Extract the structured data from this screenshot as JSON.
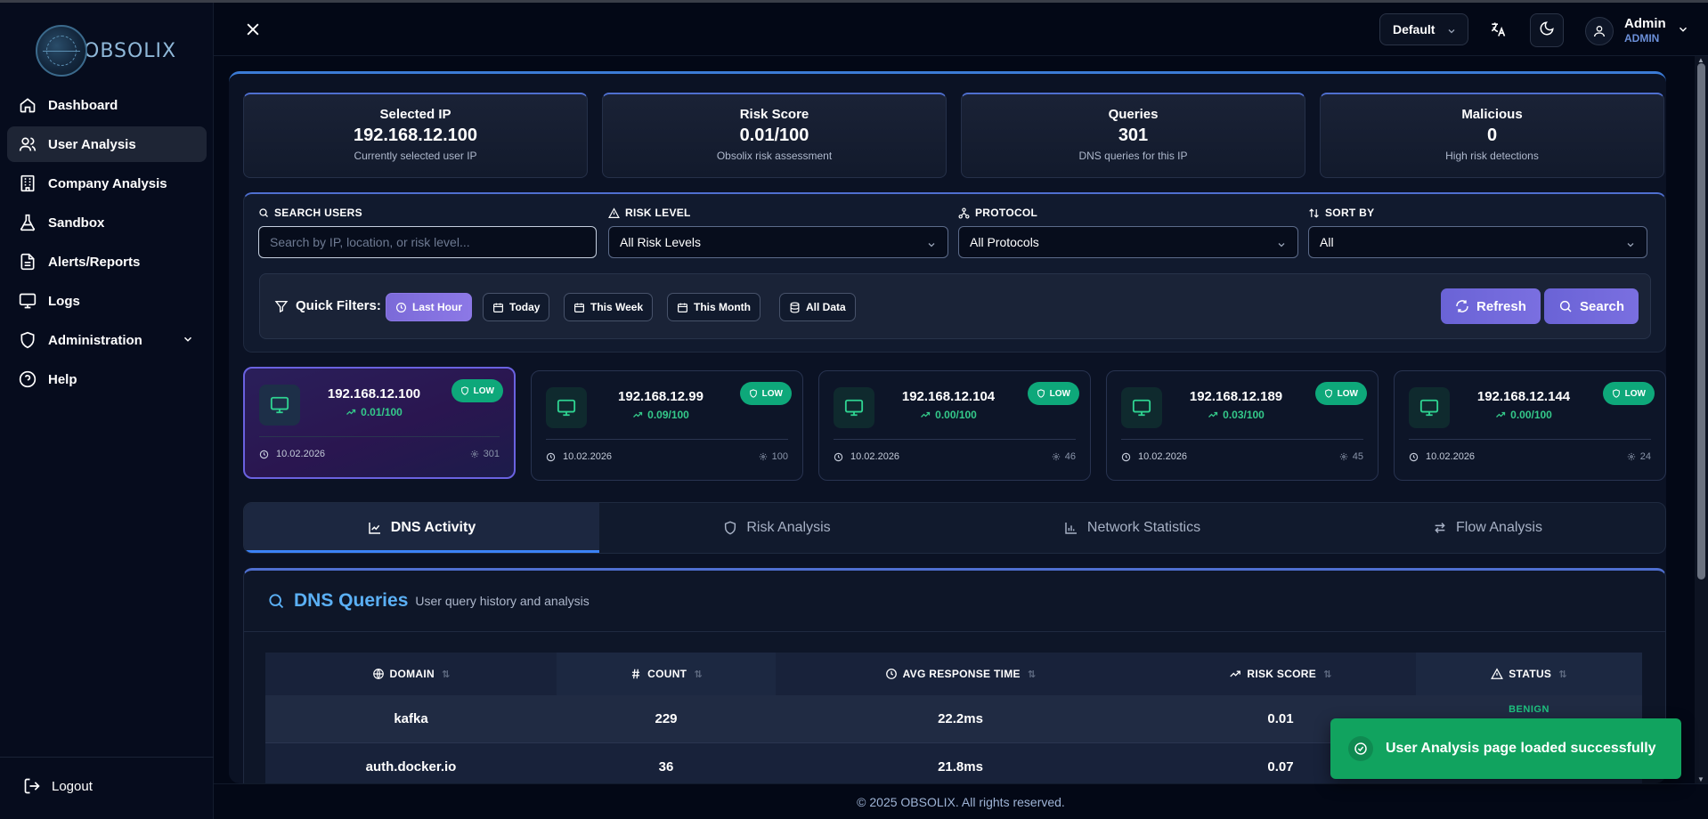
{
  "app": {
    "logo_text": "OBSOLIX",
    "colors": {
      "accent": "#6a63d6",
      "success": "#0ea87a",
      "link": "#5bb0f5",
      "background": "#030816"
    }
  },
  "sidebar": {
    "items": [
      {
        "label": "Dashboard",
        "icon": "home-icon"
      },
      {
        "label": "User Analysis",
        "icon": "users-icon",
        "active": true
      },
      {
        "label": "Company Analysis",
        "icon": "building-icon"
      },
      {
        "label": "Sandbox",
        "icon": "flask-icon"
      },
      {
        "label": "Alerts/Reports",
        "icon": "document-icon"
      },
      {
        "label": "Logs",
        "icon": "monitor-icon"
      },
      {
        "label": "Administration",
        "icon": "shield-icon",
        "expandable": true
      },
      {
        "label": "Help",
        "icon": "help-circle-icon"
      }
    ],
    "logout_label": "Logout"
  },
  "header": {
    "theme_select_value": "Default",
    "user": {
      "name": "Admin",
      "role": "ADMIN"
    }
  },
  "stats": [
    {
      "label": "Selected IP",
      "value": "192.168.12.100",
      "sub": "Currently selected user IP"
    },
    {
      "label": "Risk Score",
      "value": "0.01/100",
      "sub": "Obsolix risk assessment"
    },
    {
      "label": "Queries",
      "value": "301",
      "sub": "DNS queries for this IP"
    },
    {
      "label": "Malicious",
      "value": "0",
      "sub": "High risk detections"
    }
  ],
  "filters": {
    "search": {
      "label": "SEARCH USERS",
      "placeholder": "Search by IP, location, or risk level..."
    },
    "risk_level": {
      "label": "RISK LEVEL",
      "value": "All Risk Levels"
    },
    "protocol": {
      "label": "PROTOCOL",
      "value": "All Protocols"
    },
    "sort_by": {
      "label": "SORT BY",
      "value": "All"
    },
    "quick_label": "Quick Filters:",
    "quick": [
      "Last Hour",
      "Today",
      "This Week",
      "This Month",
      "All Data"
    ],
    "quick_active": "Last Hour",
    "refresh_label": "Refresh",
    "search_label": "Search"
  },
  "ip_cards": [
    {
      "ip": "192.168.12.100",
      "score": "0.01/100",
      "badge": "LOW",
      "date": "10.02.2026",
      "count": "301",
      "selected": true
    },
    {
      "ip": "192.168.12.99",
      "score": "0.09/100",
      "badge": "LOW",
      "date": "10.02.2026",
      "count": "100"
    },
    {
      "ip": "192.168.12.104",
      "score": "0.00/100",
      "badge": "LOW",
      "date": "10.02.2026",
      "count": "46"
    },
    {
      "ip": "192.168.12.189",
      "score": "0.03/100",
      "badge": "LOW",
      "date": "10.02.2026",
      "count": "45"
    },
    {
      "ip": "192.168.12.144",
      "score": "0.00/100",
      "badge": "LOW",
      "date": "10.02.2026",
      "count": "24"
    }
  ],
  "tabs": [
    {
      "label": "DNS Activity",
      "active": true
    },
    {
      "label": "Risk Analysis"
    },
    {
      "label": "Network Statistics"
    },
    {
      "label": "Flow Analysis"
    }
  ],
  "dns": {
    "title": "DNS Queries",
    "subtitle": "User query history and analysis",
    "columns": [
      "DOMAIN",
      "COUNT",
      "AVG RESPONSE TIME",
      "RISK SCORE",
      "STATUS"
    ],
    "rows": [
      {
        "domain": "kafka",
        "count": "229",
        "avg": "22.2ms",
        "risk": "0.01",
        "status": "BENIGN"
      },
      {
        "domain": "auth.docker.io",
        "count": "36",
        "avg": "21.8ms",
        "risk": "0.07",
        "status": ""
      }
    ]
  },
  "footer": "© 2025 OBSOLIX. All rights reserved.",
  "toast": "User Analysis page loaded successfully"
}
